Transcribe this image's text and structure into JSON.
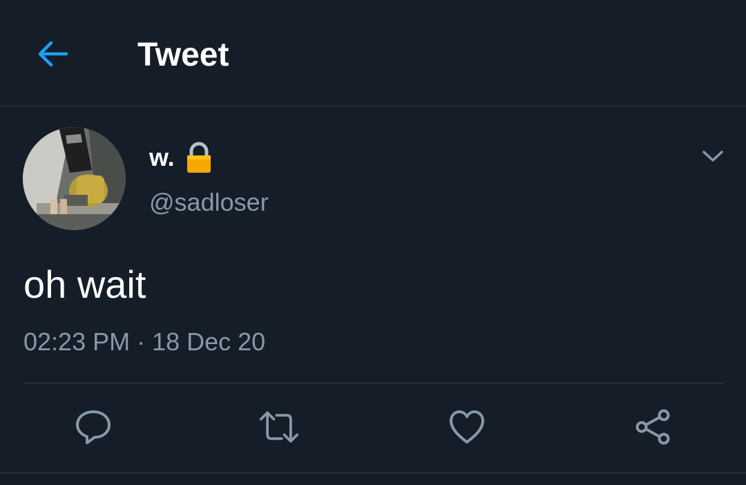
{
  "header": {
    "back_icon": "arrow-left-icon",
    "title": "Tweet"
  },
  "tweet": {
    "display_name": "w.",
    "protected_icon": "lock-icon",
    "handle": "@sadloser",
    "text": "oh wait",
    "timestamp": "02:23 PM · 18 Dec 20",
    "more_icon": "chevron-down-icon"
  },
  "actions": [
    {
      "name": "reply",
      "icon": "reply-icon"
    },
    {
      "name": "retweet",
      "icon": "retweet-icon"
    },
    {
      "name": "like",
      "icon": "heart-icon"
    },
    {
      "name": "share",
      "icon": "share-icon"
    }
  ],
  "colors": {
    "background": "#151d28",
    "accent": "#1da1f2",
    "secondary_text": "#8899a6",
    "divider": "#2f3b47",
    "primary_text": "#ffffff"
  }
}
